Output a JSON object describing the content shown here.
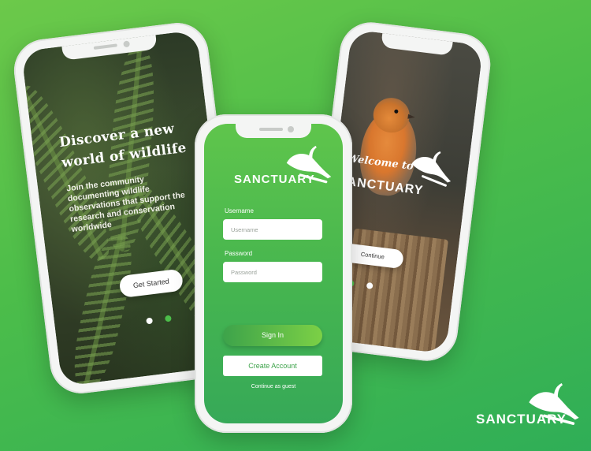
{
  "background_colors": {
    "start": "#6cc94a",
    "end": "#2fae57"
  },
  "intro_screen": {
    "title": "Discover a new world of wildlife",
    "body": "Join the community documenting wildlife observations that support the research and conservation worldwide",
    "button_label": "Get Started",
    "page_indicator": {
      "count": 2,
      "active_index": 1,
      "active_color": "#4cbd4a"
    }
  },
  "login_screen": {
    "brand": "SANCTUARY",
    "username_label": "Username",
    "username_placeholder": "Username",
    "password_label": "Password",
    "password_placeholder": "Password",
    "signin_label": "Sign In",
    "create_account_label": "Create Account",
    "guest_label": "Continue as guest"
  },
  "welcome_screen": {
    "welcome_text": "Welcome to",
    "brand": "SANCTUARY",
    "button_label": "Continue",
    "page_indicator": {
      "count": 2,
      "active_index": 0,
      "active_color": "#4cbd4a"
    }
  },
  "corner_logo": {
    "brand": "SANCTUARY"
  },
  "icons": {
    "logo": "bird-on-branch-icon"
  }
}
